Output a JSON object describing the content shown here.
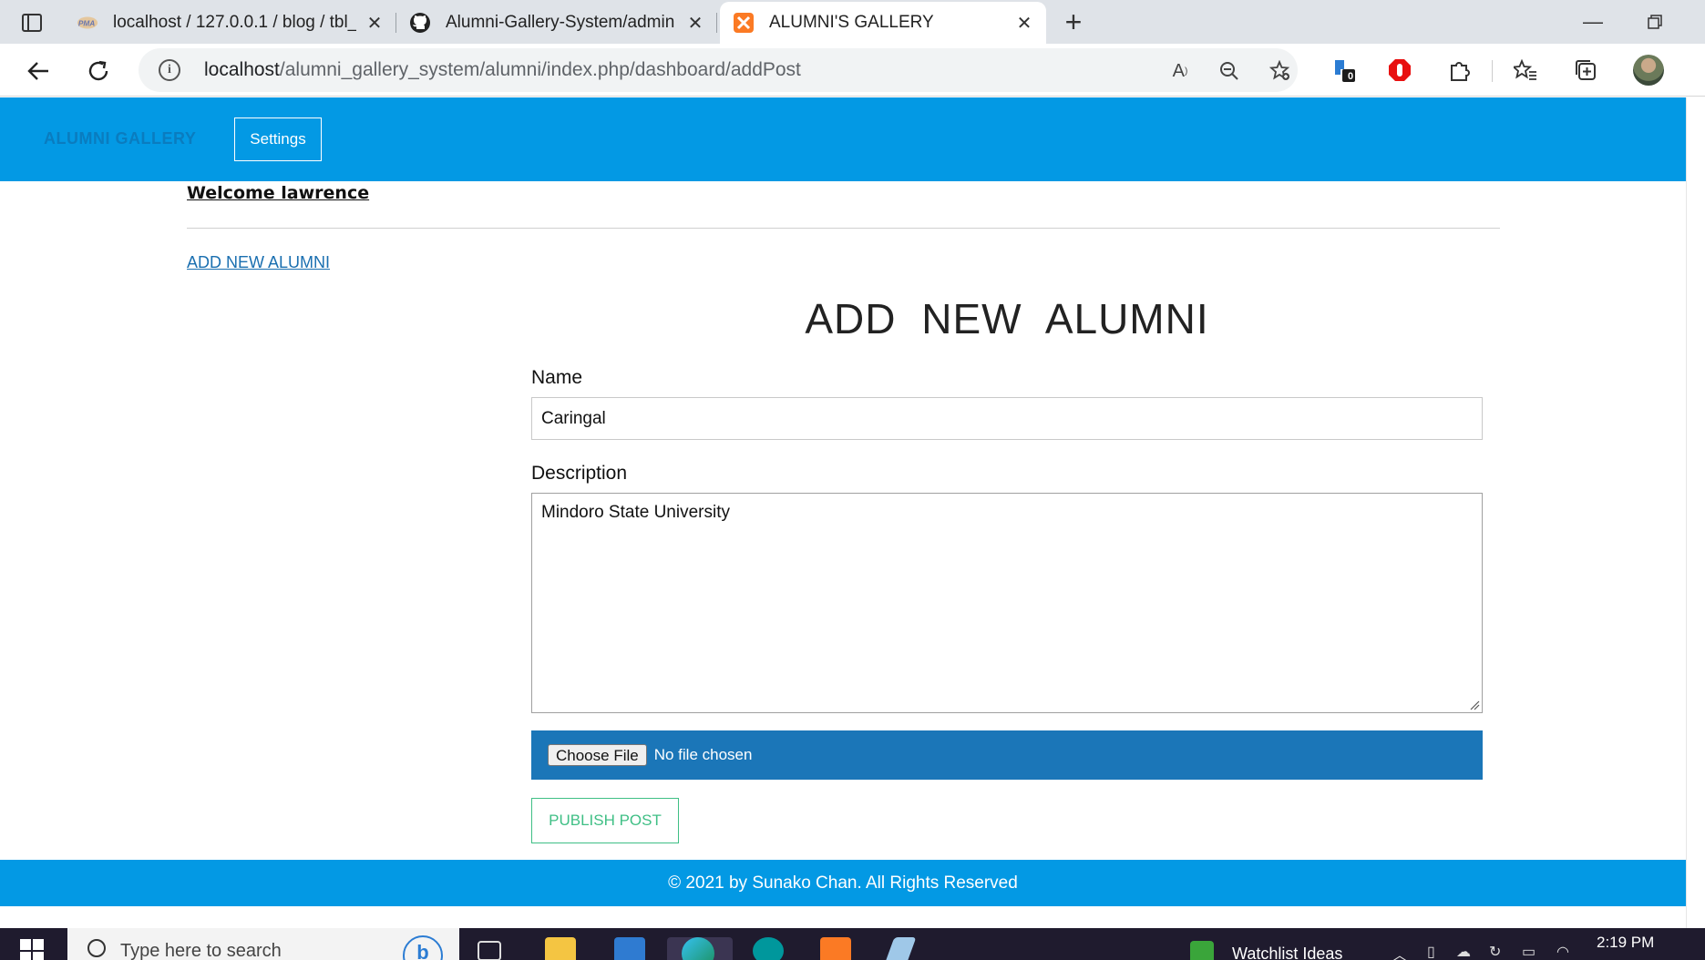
{
  "browser": {
    "tabs": [
      {
        "title": "localhost / 127.0.0.1 / blog / tbl_",
        "favicon": "phpmyadmin-icon",
        "active": false
      },
      {
        "title": "Alumni-Gallery-System/admin us",
        "favicon": "github-icon",
        "active": false
      },
      {
        "title": "ALUMNI'S GALLERY",
        "favicon": "xampp-icon",
        "active": true
      }
    ],
    "address": {
      "host": "localhost",
      "path": "/alumni_gallery_system/alumni/index.php/dashboard/addPost"
    },
    "extension_badge": "0"
  },
  "site": {
    "brand": "ALUMNI GALLERY",
    "settings_label": "Settings",
    "welcome": "Welcome lawrence",
    "add_link": "ADD NEW ALUMNI",
    "form": {
      "title": "ADD NEW ALUMNI",
      "name_label": "Name",
      "name_value": "Caringal",
      "description_label": "Description",
      "description_value": "Mindoro State University",
      "choose_file_label": "Choose File",
      "file_status": "No file chosen",
      "publish_label": "PUBLISH POST"
    },
    "footer": "© 2021 by Sunako Chan. All Rights Reserved"
  },
  "taskbar": {
    "search_placeholder": "Type here to search",
    "widget_text": "Watchlist Ideas",
    "clock": "2:19 PM"
  },
  "colors": {
    "header_blue": "#0399e4",
    "file_bar_blue": "#1b76b8",
    "publish_green": "#3fbf85",
    "link_blue": "#1a6fb0"
  }
}
